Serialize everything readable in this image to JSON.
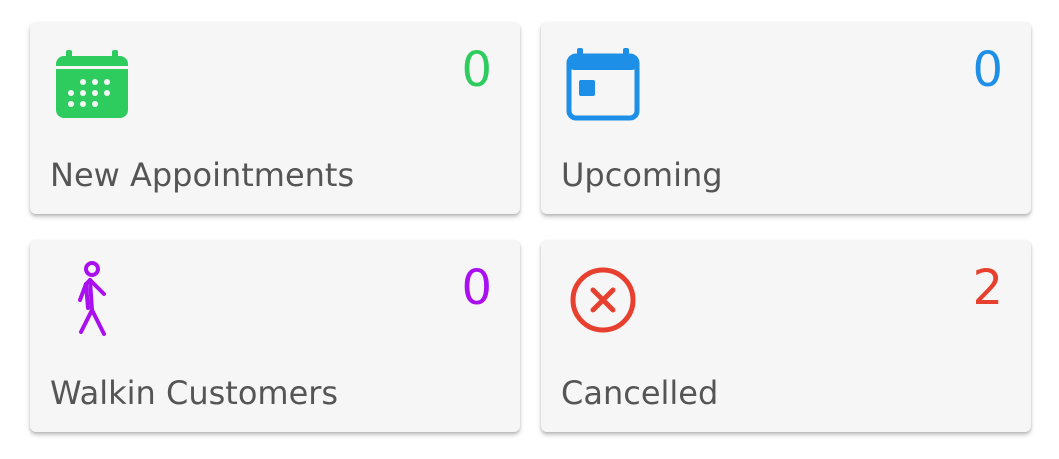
{
  "colors": {
    "green": "#2ecc5f",
    "blue": "#1e8fe6",
    "purple": "#aa0ff0",
    "red": "#e8402f",
    "label": "#555555",
    "card_background": "#f6f6f6"
  },
  "cards": [
    {
      "label": "New Appointments",
      "count": "0",
      "icon": "calendar-grid-icon"
    },
    {
      "label": "Upcoming",
      "count": "0",
      "icon": "calendar-day-icon"
    },
    {
      "label": "Walkin Customers",
      "count": "0",
      "icon": "walking-person-icon"
    },
    {
      "label": "Cancelled",
      "count": "2",
      "icon": "cancel-circle-icon"
    }
  ]
}
